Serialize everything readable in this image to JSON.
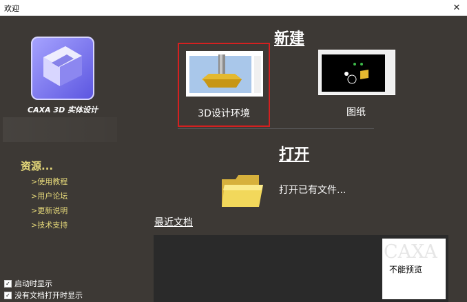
{
  "window": {
    "title": "欢迎",
    "close_label": "✕"
  },
  "sidebar": {
    "logo_caption": "CAXA 3D 实体设计",
    "resources_title": "资源...",
    "resources": [
      {
        "label": ">使用教程"
      },
      {
        "label": ">用户论坛"
      },
      {
        "label": ">更新说明"
      },
      {
        "label": ">技术支持"
      }
    ]
  },
  "checkboxes": [
    {
      "label": "启动时显示",
      "checked": true
    },
    {
      "label": "没有文档打开时显示",
      "checked": true
    }
  ],
  "new_section": {
    "title": "新建",
    "tiles": [
      {
        "label": "3D设计环境",
        "selected": true,
        "icon": "3d-gear-preview"
      },
      {
        "label": "图纸",
        "selected": false,
        "icon": "drawing-preview"
      }
    ]
  },
  "open_section": {
    "title": "打开",
    "action": "打开已有文件..."
  },
  "recent_section": {
    "title": "最近文档",
    "preview_watermark": "CAXA",
    "preview_text": "不能预览"
  },
  "colors": {
    "background": "#3d3935",
    "accent": "#e6d97a",
    "highlight": "#d42020"
  }
}
